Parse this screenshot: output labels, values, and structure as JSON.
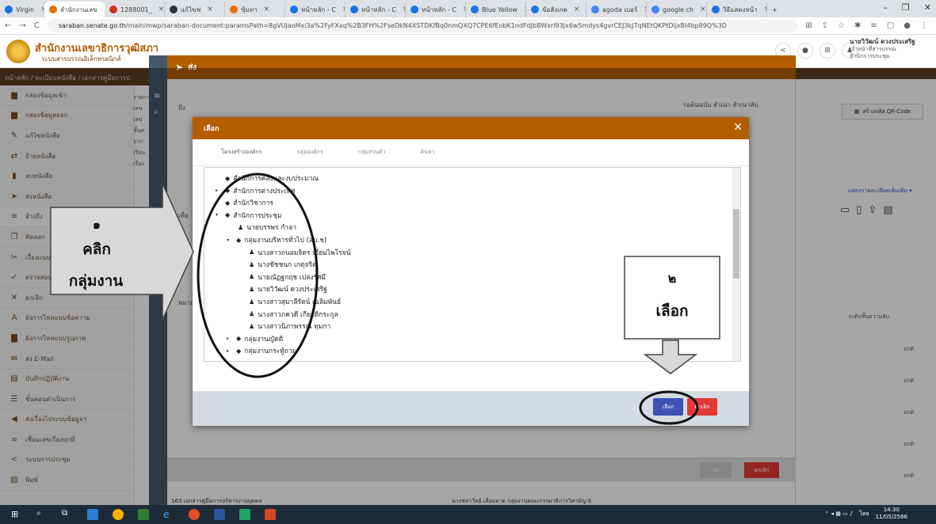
{
  "browser": {
    "tabs": [
      {
        "label": "Virgin",
        "color": "#1a73e8"
      },
      {
        "label": "สำนักงานเลข",
        "color": "#e8710a",
        "active": true
      },
      {
        "label": "1288001_",
        "color": "#d93025"
      },
      {
        "label": "แก้ไขฟ",
        "color": "#333333"
      },
      {
        "label": "ซุ้มทา",
        "color": "#e8710a"
      },
      {
        "label": "หน้าหลัก - C",
        "color": "#1a73e8"
      },
      {
        "label": "หน้าหลัก - C",
        "color": "#1a73e8"
      },
      {
        "label": "หน้าหลัก - C",
        "color": "#1a73e8"
      },
      {
        "label": "Blue Yellow",
        "color": "#1a73e8"
      },
      {
        "label": "ข้อสังเกต",
        "color": "#1a73e8"
      },
      {
        "label": "agoda เบอร์",
        "color": "#4285f4"
      },
      {
        "label": "google ch",
        "color": "#4285f4"
      },
      {
        "label": "วิธีแสดงหน้า",
        "color": "#1a73e8"
      }
    ],
    "new_tab": "+",
    "url_domain": "saraban.senate.go.th",
    "url_rest": "/main/mwp/saraban-document:paramsPath=8gVUjaoMxi3a%2FyFXxq%2B3FH%2FseDkN4XSTDKfBq0nmQXQ7CPE6fEobK1ndFdJbBWxrl93Jx6w5mdys4gvrCEJ3kJ7qNEtQKPtDljxBl4bp89Q%3D"
  },
  "app": {
    "org_name": "สำนักงานเลขาธิการวุฒิสภา",
    "org_sub": "ระบบสารบรรณอิเล็กทรอนิกส์",
    "user_name": "นายวิวัฒน์ ดวงประเสริฐ",
    "user_role": "เจ้าหน้าที่สารบรรณ",
    "user_dept": "สำนักการประชุม",
    "breadcrumb": "หน้าหลัก / ทะเบียนหนังสือ / เอกสารคู่มือการป"
  },
  "sidebar": {
    "items": [
      {
        "label": "กล่องข้อมูลเข้า",
        "icon": "inbox-icon",
        "glyph": "▆"
      },
      {
        "label": "กล่องข้อมูลออก",
        "icon": "outbox-icon",
        "glyph": "▆"
      },
      {
        "label": "แก้ไขหนังสือ",
        "icon": "pencil-icon",
        "glyph": "✎"
      },
      {
        "label": "ย้ายหนังสือ",
        "icon": "move-icon",
        "glyph": "⇄"
      },
      {
        "label": "ลบหนังสือ",
        "icon": "trash-icon",
        "glyph": "▮"
      },
      {
        "label": "ส่งหนังสือ",
        "icon": "send-icon",
        "glyph": "➤"
      },
      {
        "label": "อ้างถึง",
        "icon": "link-icon",
        "glyph": "≡"
      },
      {
        "label": "คัดลอก",
        "icon": "copy-icon",
        "glyph": "❐"
      },
      {
        "label": "เรื่องแนบ",
        "icon": "attach-icon",
        "glyph": "✂"
      },
      {
        "label": "ตรวจสอบ",
        "icon": "check-icon",
        "glyph": "✓"
      },
      {
        "label": "ยกเลิก",
        "icon": "cancel-icon",
        "glyph": "✕"
      },
      {
        "label": "ผังการไหลแบบข้อความ",
        "icon": "text-flow-icon",
        "glyph": "A"
      },
      {
        "label": "ผังการไหลแบบรูปภาพ",
        "icon": "image-flow-icon",
        "glyph": "▇"
      },
      {
        "label": "ส่ง E-Mail",
        "icon": "mail-icon",
        "glyph": "✉"
      },
      {
        "label": "บันทึกปฏิบัติงาน",
        "icon": "log-icon",
        "glyph": "▤"
      },
      {
        "label": "ขั้นตอนดำเนินการ",
        "icon": "steps-icon",
        "glyph": "☰"
      },
      {
        "label": "ส่งเรื่องไประบบข้อมูลฯ",
        "icon": "forward-icon",
        "glyph": "◀"
      },
      {
        "label": "เชื่อมเลขเรื่องทุกที่",
        "icon": "chain-icon",
        "glyph": "∞"
      },
      {
        "label": "ระบบการประชุม",
        "icon": "share-icon",
        "glyph": "<"
      },
      {
        "label": "พิมพ์",
        "icon": "print-icon",
        "glyph": "▨"
      }
    ]
  },
  "doc": {
    "title": "ส่ง",
    "to_label": "ถึง",
    "from_label": "เรื่อง",
    "purpose_label": "เพื่อ",
    "note_label": "หมายเหตุ",
    "right_tabs": "รอต้นฉบับ  สำเนา  สำเนาลับ",
    "qr_button": "สร้างรหัส QR-Code",
    "more_link": "แสดงรายละเอียดเพิ่มเติม ▾",
    "secrecy_header": "ระดับชั้นความลับ",
    "normal": "ปกติ",
    "footer_send": "ส่ง",
    "footer_cancel": "ยกเลิก",
    "bottom_text": "163 เอกสารคู่มือการบริหารงานบุคคล",
    "bottom_text2": "นางชลาวัลย์ เลื่อมลาด กลุ่มงานคณะกรรมาธิการวิสามัญ 6",
    "left_labels": [
      "รายการ",
      "เลข",
      "เลข",
      "ชั้นค",
      "จาก",
      "เรียน",
      "เรื่อง"
    ]
  },
  "modal": {
    "title": "เลือก",
    "close": "✕",
    "tabs": [
      "โครงสร้างองค์กร",
      "กลุ่มองค์กร",
      "กลุ่มส่วนตัว",
      "ค้นหา"
    ],
    "tree": [
      {
        "label": "สำนักการคลังและงบประมาณ",
        "type": "org",
        "caret": ""
      },
      {
        "label": "สำนักการต่างประเทศ",
        "type": "org",
        "caret": "▸"
      },
      {
        "label": "สำนักวิชาการ",
        "type": "org",
        "caret": "▸"
      },
      {
        "label": "สำนักการประชุม",
        "type": "org",
        "caret": "▾"
      },
      {
        "label": "นายบรรพร กำลา",
        "type": "person",
        "caret": ""
      },
      {
        "label": "กลุ่มงานบริหารทั่วไป (สบ.ช)",
        "type": "org",
        "caret": "▾"
      },
      {
        "label": "นางสาวถนอมจิตร เอี่ยมไพโรจน์",
        "type": "person",
        "caret": ""
      },
      {
        "label": "นางชัชชนก เกตุจริต",
        "type": "person",
        "caret": ""
      },
      {
        "label": "นายณัฏฐกฤช เปล่งรัศมี",
        "type": "person",
        "caret": ""
      },
      {
        "label": "นายวิวัฒน์ ดวงประเสริฐ",
        "type": "person",
        "caret": ""
      },
      {
        "label": "นางสาวสุมาลีรัตน์ เฉลิมพันธ์",
        "type": "person",
        "caret": ""
      },
      {
        "label": "นางสาวภควดี เกียรติกระกูล",
        "type": "person",
        "caret": ""
      },
      {
        "label": "นางสาวนิภาพรรณ ทุมกา",
        "type": "person",
        "caret": ""
      },
      {
        "label": "กลุ่มงานญัตติ",
        "type": "org",
        "caret": "▸"
      },
      {
        "label": "กลุ่มงานกระทู้ถาม",
        "type": "org",
        "caret": "▸"
      }
    ],
    "select_button": "เลือก",
    "cancel_button": "ยกเลิก"
  },
  "annotations": {
    "step1_num": "๑",
    "step1_line1": "คลิก",
    "step1_line2": "กลุ่มงาน",
    "step2_num": "๒",
    "step2_line1": "เลือก"
  },
  "taskbar": {
    "lang": "ไทย",
    "time": "14:30",
    "date": "11/05/2566"
  }
}
